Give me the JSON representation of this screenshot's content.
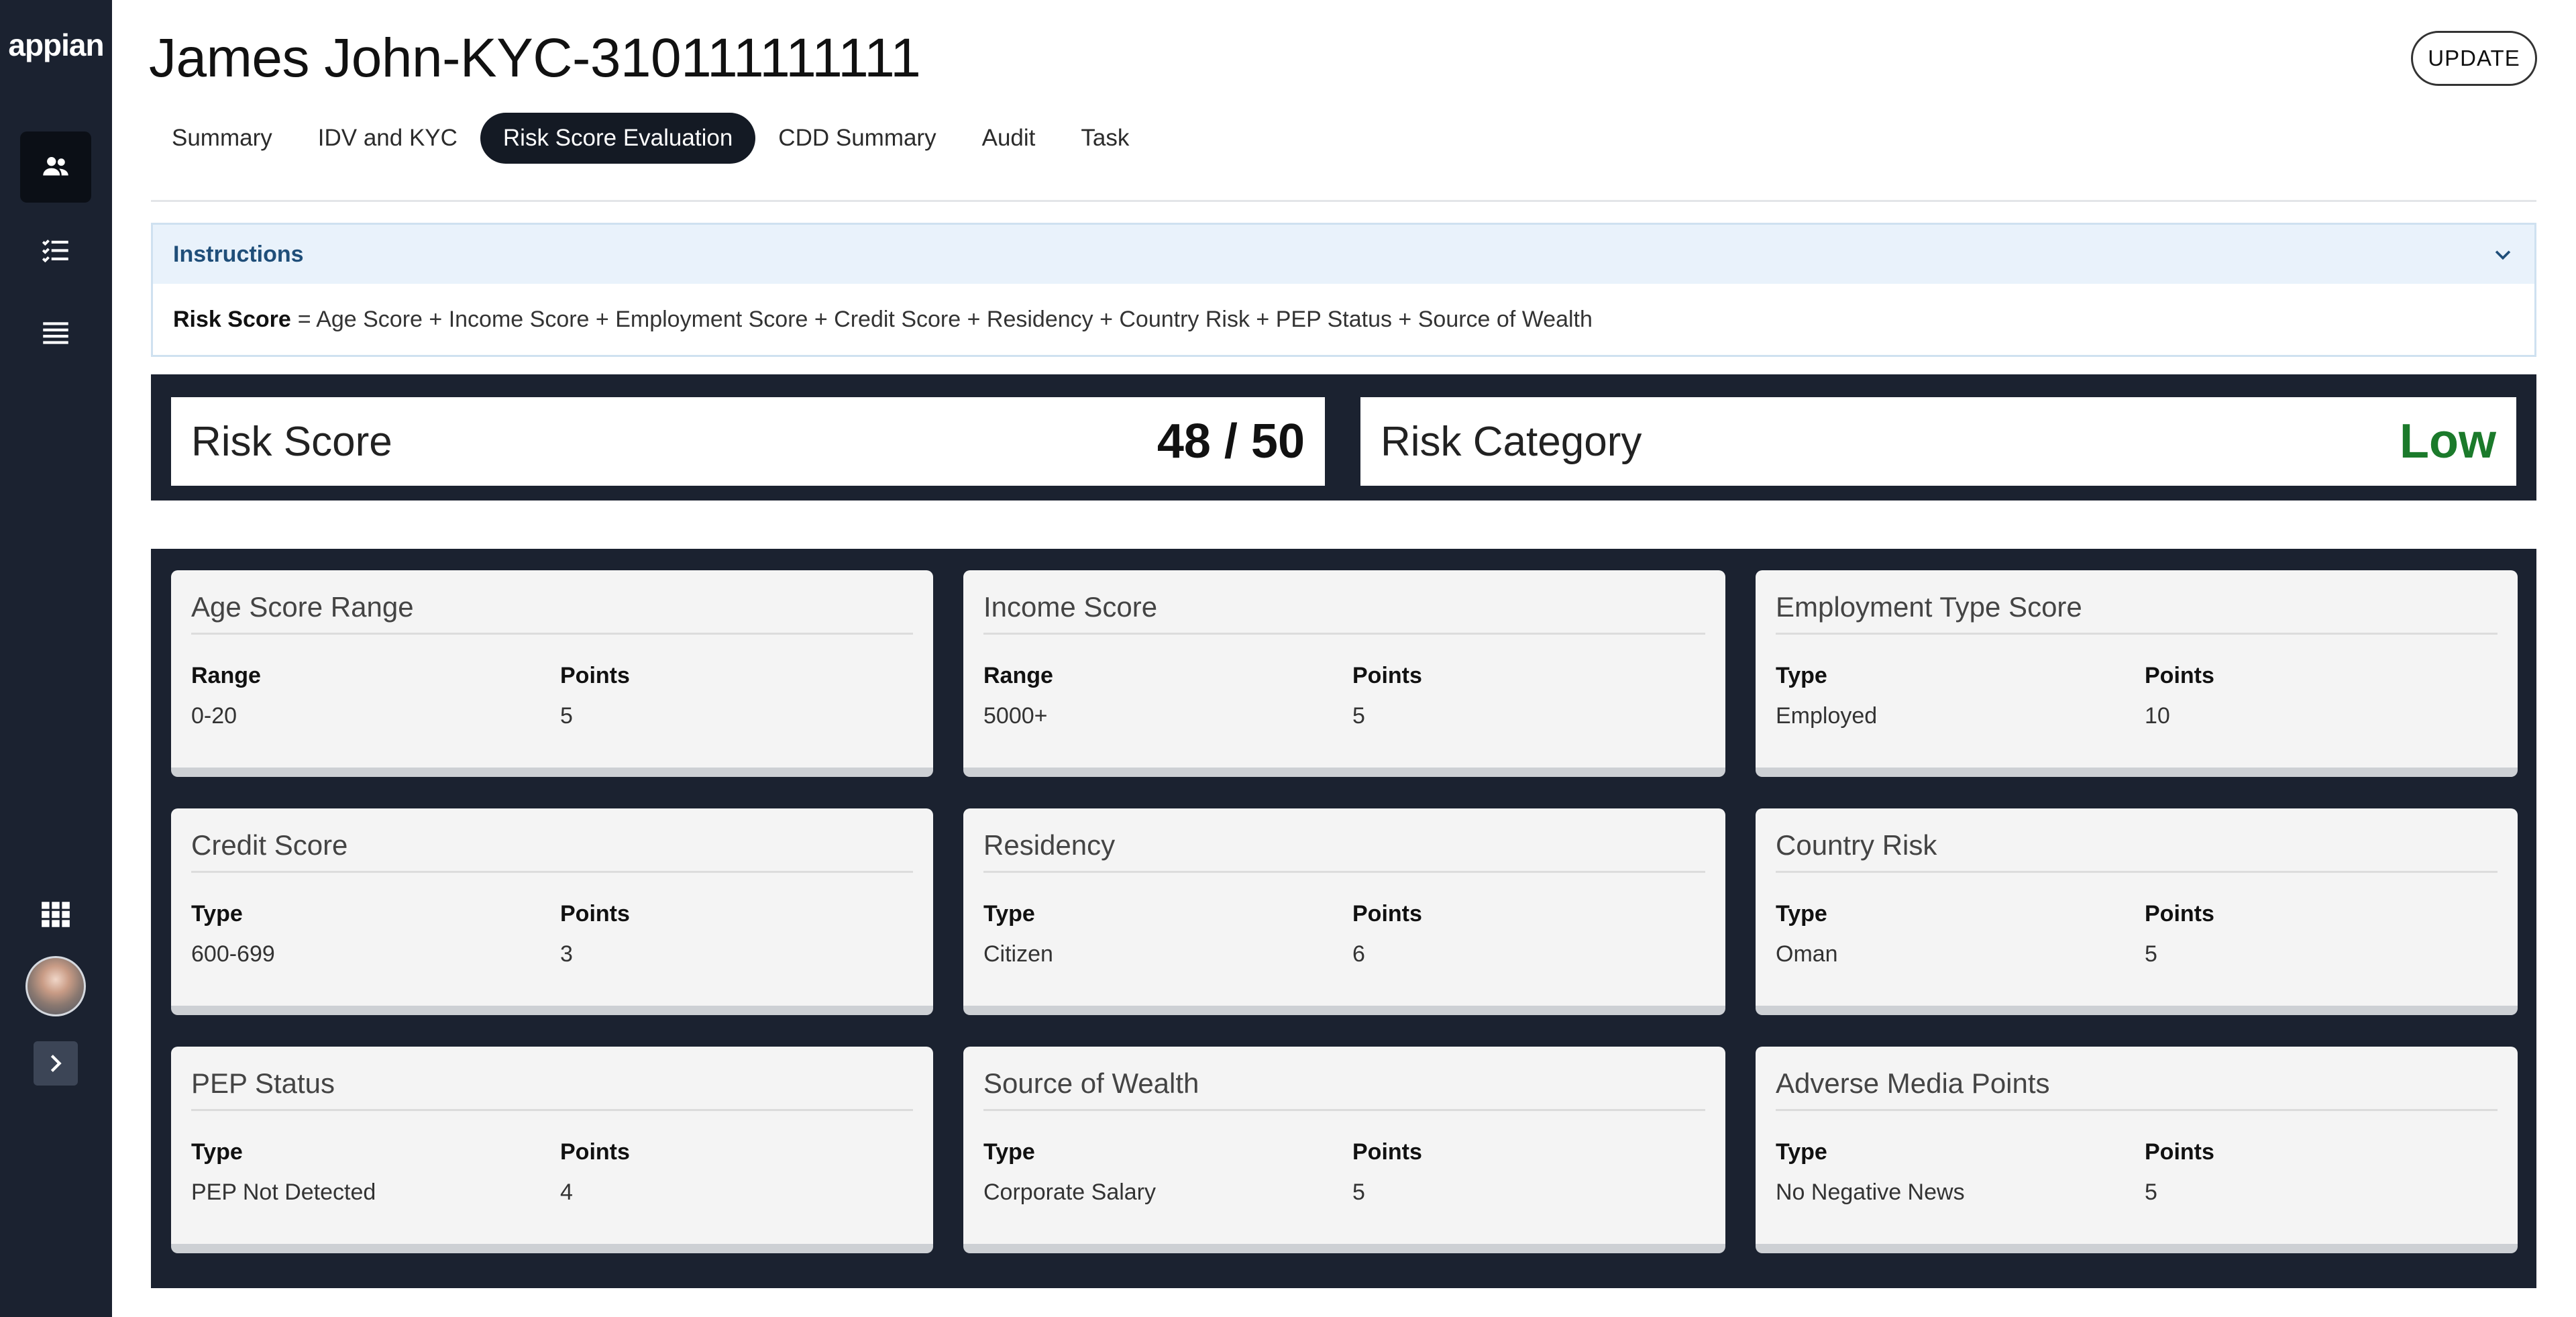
{
  "sidebar": {
    "logo": "appian",
    "nav": [
      {
        "icon": "users-icon",
        "active": true
      },
      {
        "icon": "tasks-icon",
        "active": false
      },
      {
        "icon": "list-icon",
        "active": false
      }
    ],
    "bottom_icons": [
      "apps-grid-icon",
      "user-avatar",
      "chevron-right-icon"
    ]
  },
  "header": {
    "title": "James John-KYC-310111111111",
    "update_label": "UPDATE"
  },
  "tabs": [
    {
      "label": "Summary",
      "active": false
    },
    {
      "label": "IDV and KYC",
      "active": false
    },
    {
      "label": "Risk Score Evaluation",
      "active": true
    },
    {
      "label": "CDD Summary",
      "active": false
    },
    {
      "label": "Audit",
      "active": false
    },
    {
      "label": "Task",
      "active": false
    }
  ],
  "instructions": {
    "title": "Instructions",
    "formula_label": "Risk Score",
    "formula_text": "= Age Score + Income Score + Employment Score + Credit Score + Residency + Country Risk + PEP Status + Source of Wealth"
  },
  "summary": {
    "risk_score_label": "Risk Score",
    "risk_score_value": "48 / 50",
    "risk_category_label": "Risk Category",
    "risk_category_value": "Low",
    "risk_category_color": "#1b7a2b"
  },
  "cards": [
    {
      "title": "Age Score Range",
      "col1_header": "Range",
      "col1_value": "0-20",
      "col2_header": "Points",
      "col2_value": "5"
    },
    {
      "title": "Income Score",
      "col1_header": "Range",
      "col1_value": "5000+",
      "col2_header": "Points",
      "col2_value": "5"
    },
    {
      "title": "Employment Type Score",
      "col1_header": "Type",
      "col1_value": "Employed",
      "col2_header": "Points",
      "col2_value": "10"
    },
    {
      "title": "Credit Score",
      "col1_header": "Type",
      "col1_value": "600-699",
      "col2_header": "Points",
      "col2_value": "3"
    },
    {
      "title": "Residency",
      "col1_header": "Type",
      "col1_value": "Citizen",
      "col2_header": "Points",
      "col2_value": "6"
    },
    {
      "title": "Country Risk",
      "col1_header": "Type",
      "col1_value": "Oman",
      "col2_header": "Points",
      "col2_value": "5"
    },
    {
      "title": "PEP Status",
      "col1_header": "Type",
      "col1_value": "PEP Not Detected",
      "col2_header": "Points",
      "col2_value": "4"
    },
    {
      "title": "Source of Wealth",
      "col1_header": "Type",
      "col1_value": "Corporate Salary",
      "col2_header": "Points",
      "col2_value": "5"
    },
    {
      "title": "Adverse Media Points",
      "col1_header": "Type",
      "col1_value": "No Negative News",
      "col2_header": "Points",
      "col2_value": "5"
    }
  ],
  "colors": {
    "sidebar_bg": "#1b2230",
    "active_tab_bg": "#141a24",
    "instructions_header_bg": "#e9f2fb",
    "low_risk": "#1b7a2b"
  }
}
